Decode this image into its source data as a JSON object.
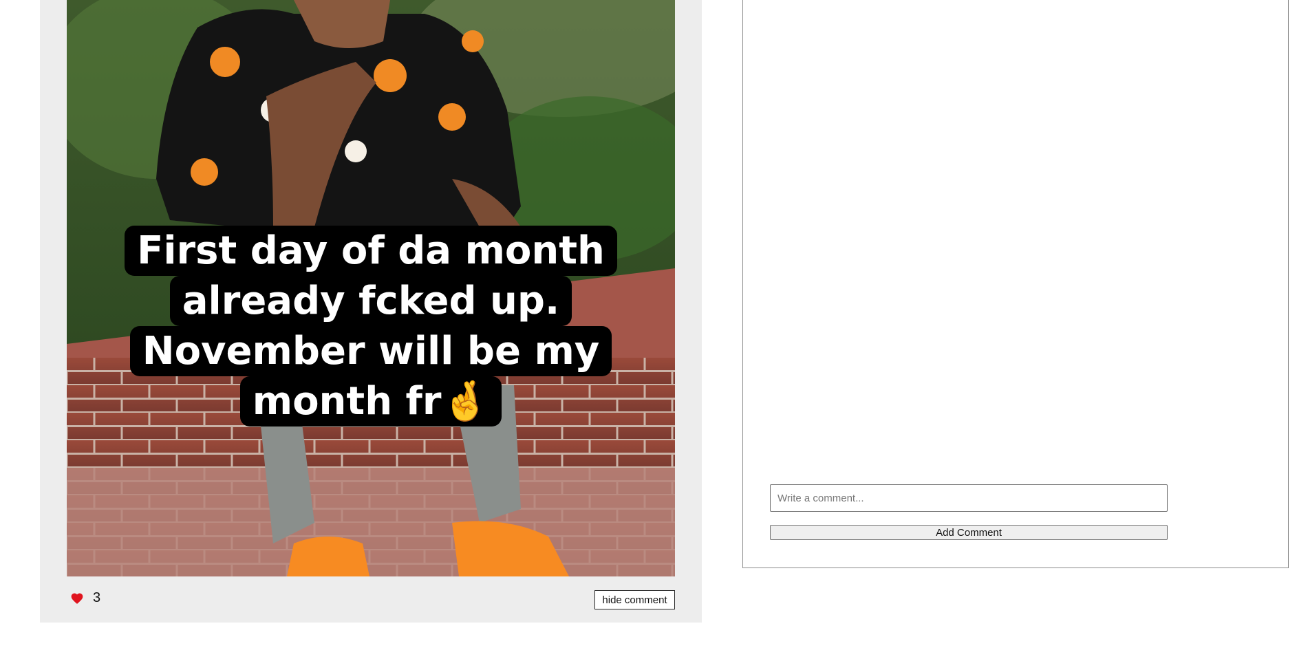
{
  "post": {
    "image_alt": "Post photo",
    "caption_lines": [
      "First day of da month",
      "already fcked up.",
      "November will be my",
      "month fr🤞"
    ],
    "likes": "3",
    "hide_comment_label": "hide comment",
    "like_color": "#e0141e"
  },
  "comments": {
    "input_placeholder": "Write a comment...",
    "add_button_label": "Add Comment"
  }
}
